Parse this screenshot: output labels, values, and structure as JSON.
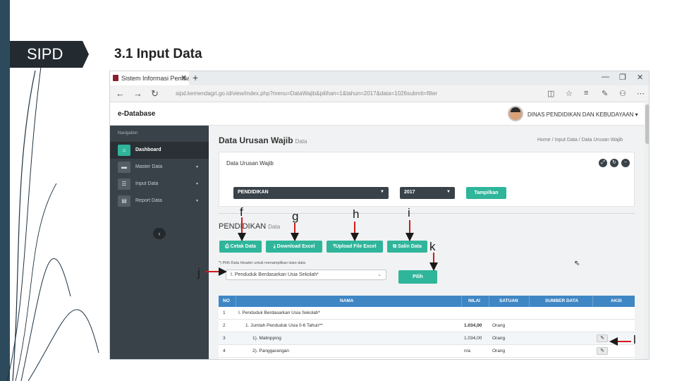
{
  "slide": {
    "tag": "SIPD",
    "title": "3.1 Input Data"
  },
  "browser": {
    "tab_title": "Sistem Informasi Pemba",
    "tab_close": "✕",
    "new_tab": "+",
    "url": "sipd.kemendagri.go.id/view/index.php?menu=DataWajib&pilihan=1&tahun=2017&data=1026submit=filter",
    "window_buttons": [
      "—",
      "❐",
      "✕"
    ]
  },
  "app": {
    "logo": "e-Database",
    "user": "DINAS PENDIDIKAN DAN KEBUDAYAAN ▾"
  },
  "sidebar": {
    "heading": "Navigation",
    "items": [
      {
        "label": "Dashboard",
        "icon": "home-icon",
        "glyph": "⌂",
        "active": true
      },
      {
        "label": "Master Data",
        "icon": "folder-icon",
        "glyph": "▬",
        "caret": "▾"
      },
      {
        "label": "Input Data",
        "icon": "list-icon",
        "glyph": "☰",
        "caret": "▾"
      },
      {
        "label": "Report Data",
        "icon": "report-icon",
        "glyph": "▤",
        "caret": "▾"
      }
    ],
    "collapse": "‹"
  },
  "content": {
    "page_title": "Data Urusan Wajib",
    "page_sub": "Data",
    "breadcrumb": "Home  /  Input Data  /  Data Urusan Wajib",
    "panel_title": "Data Urusan Wajib",
    "select_urusan": "PENDIDIKAN",
    "select_tahun": "2017",
    "btn_tampilkan": "Tampilkan",
    "section_title": "PENDIDIKAN",
    "section_sub": "Data",
    "actions": {
      "cetak": "⎙ Cetak Data",
      "download": "⤓ Download Excel",
      "upload": "⤒Upload File Excel",
      "salin": "⧉ Salin Data"
    },
    "hint": "*) Pilih Data Header untuk menampilkan isian data",
    "header_select": "I. Penduduk Berdasarkan Usia Sekolah*",
    "btn_pilih": "Pilih"
  },
  "table": {
    "headers": [
      "NO",
      "NAMA",
      "NILAI",
      "SATUAN",
      "SUMBER DATA",
      "AKSI"
    ],
    "rows": [
      {
        "no": "1",
        "nama": "I. Penduduk Berdasarkan Usia Sekolah*",
        "nilai": "",
        "satuan": "",
        "aksi": false
      },
      {
        "no": "2",
        "nama": "1. Jumlah Penduduk Usia 0-6 Tahun**",
        "nilai": "1.034,00",
        "satuan": "Orang",
        "aksi": false
      },
      {
        "no": "3",
        "nama": "1). Malinpping",
        "nilai": "1.034,00",
        "satuan": "Orang",
        "aksi": true
      },
      {
        "no": "4",
        "nama": "2). Panggarangan",
        "nilai": "n/a",
        "satuan": "Orang",
        "aksi": true
      }
    ]
  },
  "annotations": [
    "f",
    "g",
    "h",
    "i",
    "j",
    "k",
    "l"
  ],
  "colors": {
    "accent_green": "#2fb59a",
    "table_header_blue": "#3f86c4",
    "sidebar_dark": "#3a4249",
    "annotation_red": "#d11a1a"
  }
}
